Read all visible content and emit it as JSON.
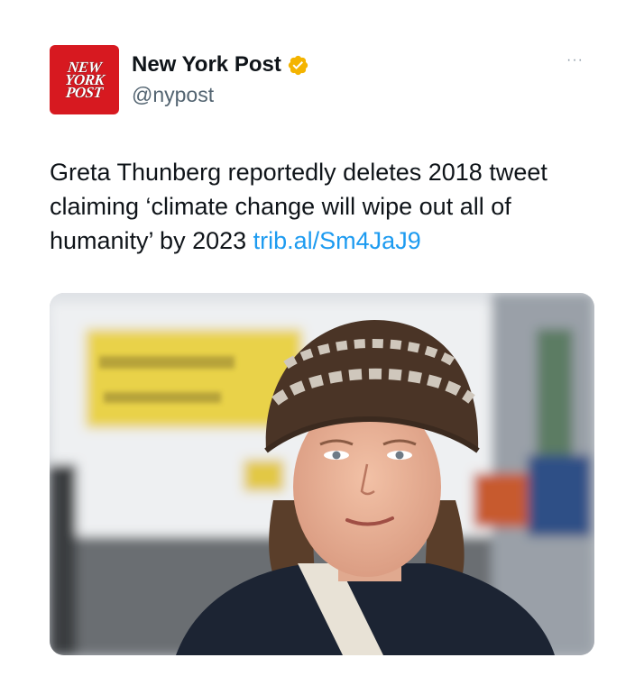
{
  "account": {
    "name": "New York Post",
    "handle": "@nypost",
    "verified": true,
    "verified_color": "#f4b400",
    "avatar_lines": [
      "NEW",
      "YORK",
      "POST"
    ],
    "avatar_color": "#d71920"
  },
  "menu": {
    "more_label": "···"
  },
  "tweet": {
    "text": "Greta Thunberg reportedly deletes 2018 tweet claiming ‘climate change will wipe out all of humanity’ by 2023 ",
    "link": "trib.al/Sm4JaJ9",
    "link_color": "#1d9bf0"
  },
  "media": {
    "icon": "photo-of-person-in-knit-hat"
  }
}
